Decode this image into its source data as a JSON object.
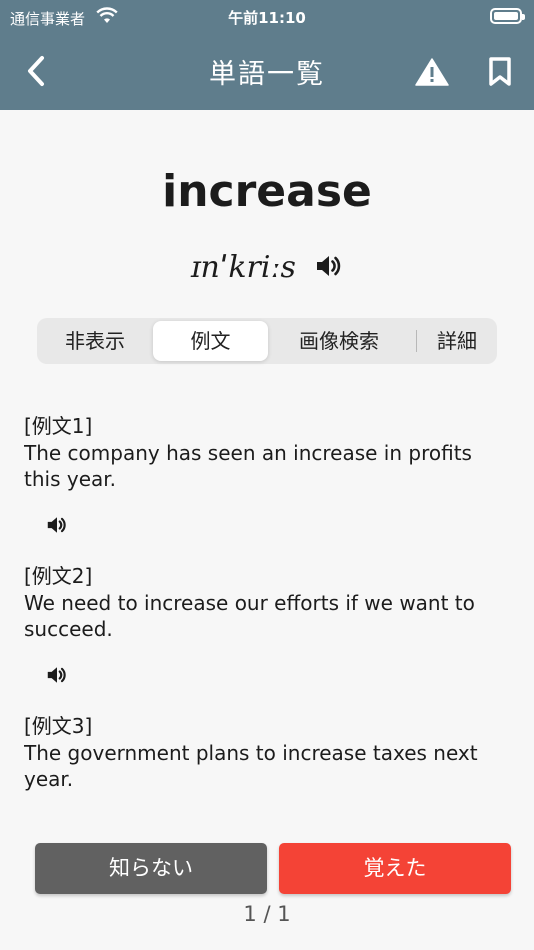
{
  "status_bar": {
    "carrier": "通信事業者",
    "time": "午前11:10"
  },
  "nav": {
    "title": "単語一覧",
    "back_icon": "chevron-left-icon",
    "warning_icon": "warning-icon",
    "bookmark_icon": "bookmark-icon"
  },
  "word": {
    "text": "increase",
    "pronunciation": "ɪnˈkriːs"
  },
  "segments": {
    "items": [
      "非表示",
      "例文",
      "画像検索",
      "詳細"
    ],
    "selected": "例文"
  },
  "examples": [
    {
      "label": "[例文1]",
      "text": "The company has seen an increase in profits this year."
    },
    {
      "label": "[例文2]",
      "text": "We need to increase our efforts if we want to succeed."
    },
    {
      "label": "[例文3]",
      "text": "The government plans to increase taxes next year."
    }
  ],
  "buttons": {
    "unknown": "知らない",
    "known": "覚えた"
  },
  "pager": "1 / 1",
  "colors": {
    "header": "#5f7d8c",
    "known": "#f44336",
    "unknown": "#616161"
  }
}
